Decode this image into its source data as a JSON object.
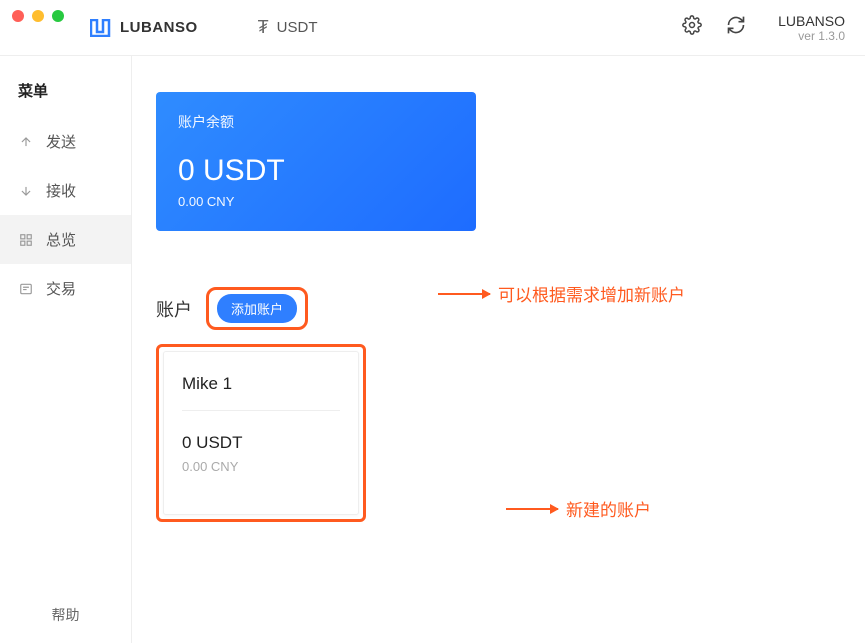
{
  "brand": "LUBANSO",
  "version": "ver 1.3.0",
  "currency": {
    "symbol": "₮",
    "label": "USDT"
  },
  "sidebar": {
    "title": "菜单",
    "items": [
      {
        "label": "发送"
      },
      {
        "label": "接收"
      },
      {
        "label": "总览"
      },
      {
        "label": "交易"
      }
    ],
    "help": "帮助"
  },
  "balance": {
    "title": "账户余额",
    "amount": "0 USDT",
    "sub": "0.00 CNY"
  },
  "accounts": {
    "title": "账户",
    "add_label": "添加账户",
    "card": {
      "name": "Mike 1",
      "amount": "0 USDT",
      "sub": "0.00 CNY"
    }
  },
  "annotations": {
    "add_account": "可以根据需求增加新账户",
    "new_account": "新建的账户"
  }
}
